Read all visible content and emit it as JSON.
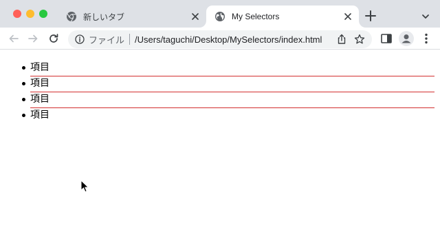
{
  "browser": {
    "tabs": [
      {
        "title": "新しいタブ",
        "active": false,
        "icon": "chrome-icon"
      },
      {
        "title": "My Selectors",
        "active": true,
        "icon": "globe-icon"
      }
    ],
    "omnibox": {
      "chip": "ファイル",
      "url": "/Users/taguchi/Desktop/MySelectors/index.html"
    }
  },
  "page": {
    "items": [
      "項目",
      "項目",
      "項目",
      "項目"
    ],
    "separator_color": "#d32f2f"
  }
}
